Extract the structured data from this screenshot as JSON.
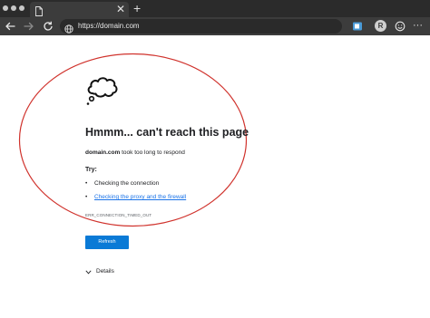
{
  "browser": {
    "new_tab_glyph": "+",
    "tab_close_glyph": "✕",
    "address_url": "https://domain.com",
    "profile_initial": "R",
    "more_glyph": "···",
    "icons": {
      "back": "back-arrow-icon",
      "forward": "forward-arrow-icon",
      "reload": "reload-icon",
      "site": "globe-icon",
      "collections": "collections-icon",
      "emoji": "smiley-icon"
    }
  },
  "error_page": {
    "title": "Hmmm... can't reach this page",
    "host": "domain.com",
    "description_suffix": " took too long to respond",
    "try_label": "Try:",
    "suggestions": [
      "Checking the connection",
      "Checking the proxy and the firewall"
    ],
    "error_code": "ERR_CONNECTION_TIMED_OUT",
    "refresh_label": "Refresh",
    "details_label": "Details"
  },
  "colors": {
    "chrome_dark": "#2b2b2b",
    "toolbar": "#3c3c3c",
    "link": "#1a73e8",
    "button": "#0a7ad6",
    "annotation_red": "#d0322c"
  }
}
